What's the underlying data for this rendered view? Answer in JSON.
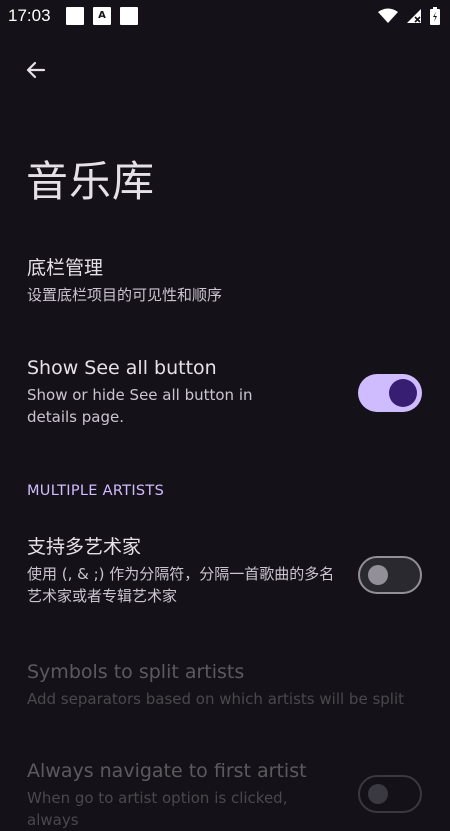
{
  "status_bar": {
    "time": "17:03",
    "notification_icons": [
      "notification-icon",
      "a-notification-icon",
      "notification-icon"
    ],
    "a_icon_label": "A",
    "system_icons": [
      "wifi-icon",
      "signal-icon",
      "battery-icon"
    ]
  },
  "toolbar": {
    "back_icon": "arrow-back-icon"
  },
  "page": {
    "title": "音乐库"
  },
  "prefs": {
    "bottom_bar": {
      "title": "底栏管理",
      "summary": "设置底栏项目的可见性和顺序"
    },
    "see_all": {
      "title": "Show See all button",
      "summary": "Show or hide See all button in details page.",
      "enabled": true
    },
    "section_multiple_artists": "MULTIPLE ARTISTS",
    "multi_artist": {
      "title": "支持多艺术家",
      "summary": "使用 (, & ;) 作为分隔符，分隔一首歌曲的多名艺术家或者专辑艺术家",
      "enabled": false
    },
    "symbols": {
      "title": "Symbols to split artists",
      "summary": "Add separators based on which artists will be split"
    },
    "navigate_first": {
      "title": "Always navigate to first artist",
      "summary": "When go to artist option is clicked, always"
    }
  },
  "colors": {
    "background": "#141218",
    "accent": "#cfbcff",
    "on_accent": "#381e72"
  }
}
